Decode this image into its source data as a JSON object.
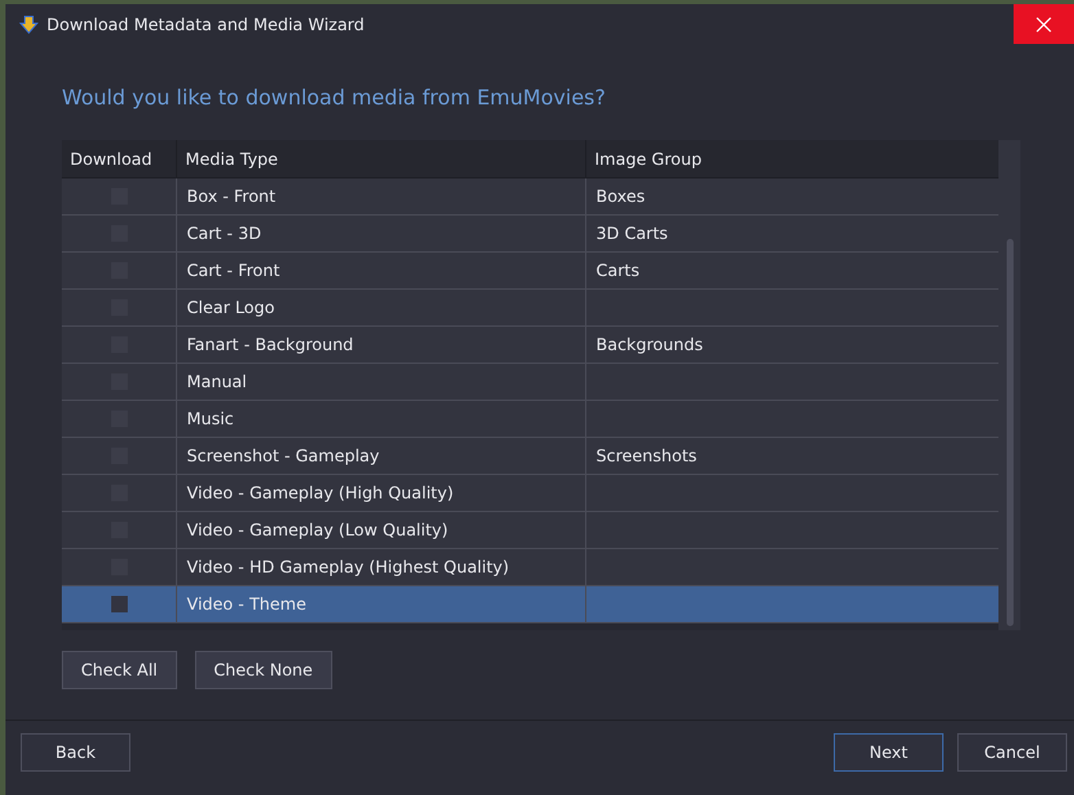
{
  "window": {
    "title": "Download Metadata and Media Wizard"
  },
  "heading": "Would you like to download media from EmuMovies?",
  "table": {
    "columns": [
      "Download",
      "Media Type",
      "Image Group"
    ],
    "rows": [
      {
        "checked": false,
        "selected": false,
        "media_type": "Box - Front",
        "image_group": "Boxes"
      },
      {
        "checked": false,
        "selected": false,
        "media_type": "Cart - 3D",
        "image_group": "3D Carts"
      },
      {
        "checked": false,
        "selected": false,
        "media_type": "Cart - Front",
        "image_group": "Carts"
      },
      {
        "checked": false,
        "selected": false,
        "media_type": "Clear Logo",
        "image_group": ""
      },
      {
        "checked": false,
        "selected": false,
        "media_type": "Fanart - Background",
        "image_group": "Backgrounds"
      },
      {
        "checked": false,
        "selected": false,
        "media_type": "Manual",
        "image_group": ""
      },
      {
        "checked": false,
        "selected": false,
        "media_type": "Music",
        "image_group": ""
      },
      {
        "checked": false,
        "selected": false,
        "media_type": "Screenshot - Gameplay",
        "image_group": "Screenshots"
      },
      {
        "checked": false,
        "selected": false,
        "media_type": "Video - Gameplay (High Quality)",
        "image_group": ""
      },
      {
        "checked": false,
        "selected": false,
        "media_type": "Video - Gameplay (Low Quality)",
        "image_group": ""
      },
      {
        "checked": false,
        "selected": false,
        "media_type": "Video - HD Gameplay (Highest Quality)",
        "image_group": ""
      },
      {
        "checked": false,
        "selected": true,
        "media_type": "Video - Theme",
        "image_group": ""
      }
    ]
  },
  "table_buttons": [
    "Check All",
    "Check None"
  ],
  "footer_buttons": [
    {
      "label": "Back",
      "default": false
    },
    {
      "label": "Next",
      "default": true
    },
    {
      "label": "Cancel",
      "default": false
    }
  ]
}
